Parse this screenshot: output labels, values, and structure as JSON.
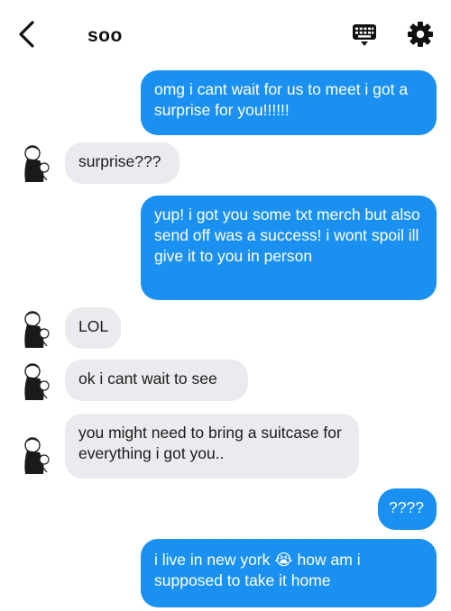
{
  "header": {
    "contact_name": "soo",
    "back_icon": "chevron-left-icon",
    "keyboard_icon": "keyboard-icon",
    "settings_icon": "gear-icon"
  },
  "colors": {
    "outgoing_bubble": "#1a91f0",
    "incoming_bubble": "#e9ebee"
  },
  "messages": [
    {
      "direction": "outgoing",
      "text": "omg i cant wait for us to meet i got a surprise for you!!!!!!"
    },
    {
      "direction": "incoming",
      "text": "surprise???"
    },
    {
      "direction": "outgoing",
      "text": "yup! i got you some txt merch but also send off was a success! i wont spoil ill give it to you in person"
    },
    {
      "direction": "incoming",
      "text": "LOL"
    },
    {
      "direction": "incoming",
      "text": "ok i cant wait to see"
    },
    {
      "direction": "incoming",
      "text": "you might need to bring a suitcase for everything i got you.."
    },
    {
      "direction": "outgoing",
      "text": "????"
    },
    {
      "direction": "outgoing",
      "text": "i live in new york 😭  how am i supposed to take it home"
    }
  ]
}
